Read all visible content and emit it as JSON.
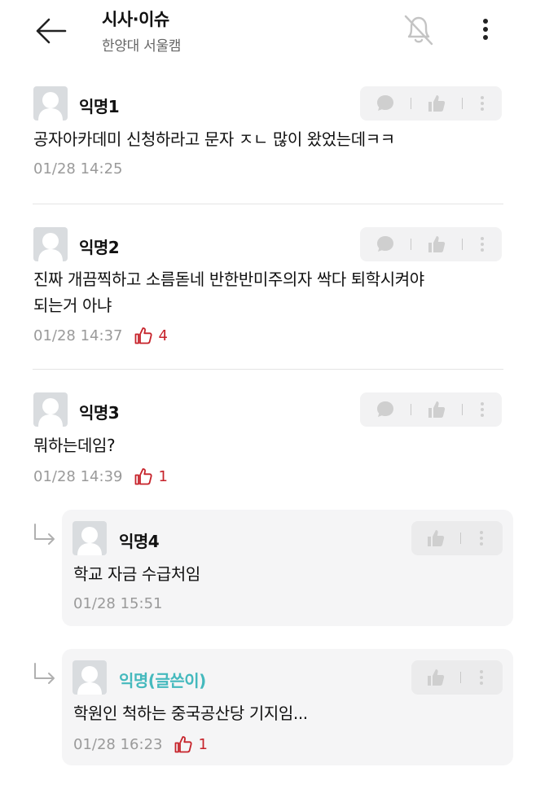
{
  "header": {
    "title": "시사·이슈",
    "subtitle": "한양대 서울캠"
  },
  "comments": [
    {
      "nickname": "익명1",
      "text": "공자아카데미 신청하라고 문자 ㅈㄴ 많이 왔었는데ㅋㅋ",
      "time": "01/28 14:25",
      "likes": ""
    },
    {
      "nickname": "익명2",
      "text_line1": "진짜 개끔찍하고 소름돋네 반한반미주의자 싹다 퇴학시켜야",
      "text_line2": "되는거 아냐",
      "time": "01/28 14:37",
      "likes": "4"
    },
    {
      "nickname": "익명3",
      "text": "뭐하는데임?",
      "time": "01/28 14:39",
      "likes": "1"
    }
  ],
  "replies": [
    {
      "nickname": "익명4",
      "text": "학교 자금 수급처임",
      "time": "01/28 15:51",
      "likes": ""
    },
    {
      "nickname": "익명(글쓴이)",
      "text": "학원인 척하는 중국공산당 기지임...",
      "time": "01/28 16:23",
      "likes": "1"
    }
  ],
  "colors": {
    "accent_like": "#c6222a",
    "author_nick": "#44b9bd",
    "action_bar_bg": "#f2f2f3",
    "reply_bg": "#f5f5f6"
  },
  "icons": [
    "back-arrow-icon",
    "bell-off-icon",
    "more-vertical-icon",
    "avatar-icon",
    "comment-icon",
    "thumbs-up-icon",
    "reply-arrow-icon"
  ]
}
